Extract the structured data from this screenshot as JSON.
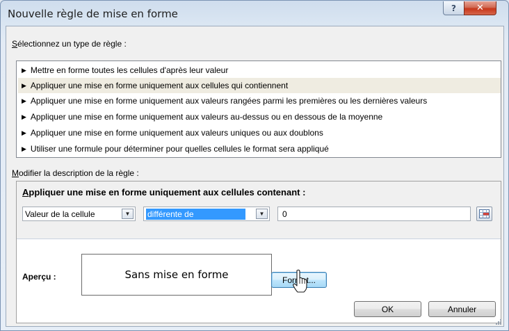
{
  "dialog": {
    "title": "Nouvelle règle de mise en forme",
    "help_label": "?",
    "close_label": "✕"
  },
  "rule_type": {
    "label_mnemonic": "S",
    "label_rest": "électionnez un type de règle :",
    "selected_index": 1,
    "items": [
      {
        "label": "Mettre en forme toutes les cellules d'après leur valeur"
      },
      {
        "label": "Appliquer une mise en forme uniquement aux cellules qui contiennent"
      },
      {
        "label": "Appliquer une mise en forme uniquement aux valeurs rangées parmi les premières ou les dernières valeurs"
      },
      {
        "label": "Appliquer une mise en forme uniquement aux valeurs au-dessus ou en dessous de la moyenne"
      },
      {
        "label": "Appliquer une mise en forme uniquement aux valeurs uniques ou aux doublons"
      },
      {
        "label": "Utiliser une formule pour déterminer pour quelles cellules le format sera appliqué"
      }
    ]
  },
  "description": {
    "label_mnemonic": "M",
    "label_rest": "odifier la description de la règle :",
    "heading_mnemonic": "A",
    "heading_rest": "ppliquer une mise en forme uniquement aux cellules contenant :",
    "condition_combo": {
      "value": "Valeur de la cellule"
    },
    "operator_combo": {
      "value": "différente de"
    },
    "value_field": {
      "value": "0"
    },
    "preview_label": "Aperçu :",
    "preview_text": "Sans mise en forme",
    "format_button": "Format..."
  },
  "footer": {
    "ok_button": "OK",
    "cancel_button": "Annuler"
  },
  "colors": {
    "selected_row": "#efece1",
    "selection_highlight": "#3399ff",
    "close_button": "#c7371b"
  }
}
